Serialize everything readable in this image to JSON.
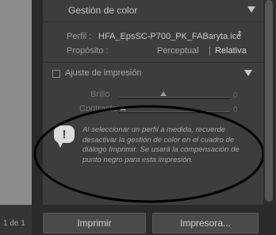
{
  "footer": {
    "page_count": "1 de 1"
  },
  "color_section": {
    "title": "Gestión de color",
    "profile_label": "Perfil :",
    "profile_value": "HFA_EpsSC-P700_PK_FABaryta.icc",
    "profile_stepper": "⇕",
    "purpose_label": "Propósito :",
    "purpose_options": [
      "Perceptual",
      "Relativa"
    ],
    "purpose_selected": "Relativa"
  },
  "print_adjust": {
    "title": "Ajuste de impresión",
    "enabled": false,
    "brightness_label": "Brillo",
    "brightness_value": "0",
    "contrast_label": "Contraste",
    "contrast_value": "0"
  },
  "info_message": {
    "icon": "speech-bubble-exclamation-icon",
    "text": "Al seleccionar un perfil a medida, recuerde desactivar la gestión de color en el cuadro de diálogo Imprimir. Se usará la compensación de punto negro para esta impresión."
  },
  "buttons": {
    "print": "Imprimir",
    "printer": "Impresora..."
  },
  "colors": {
    "panel_bg": "#3d3d3d",
    "annotation": "#000000"
  }
}
